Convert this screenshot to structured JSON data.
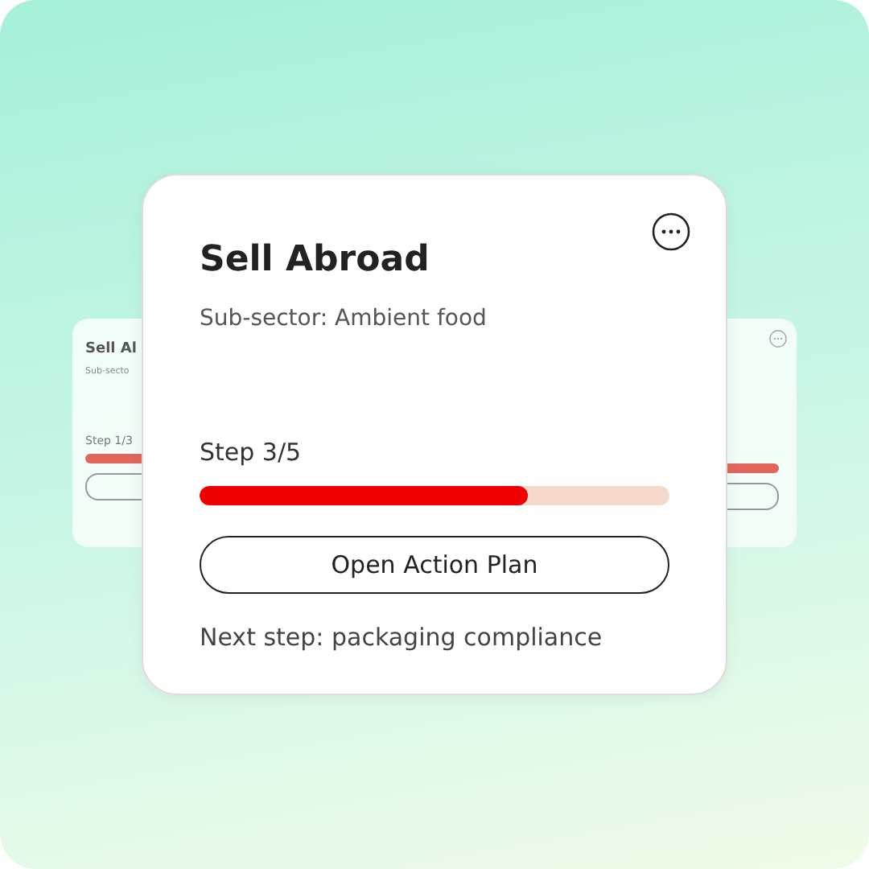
{
  "back_cards": [
    {
      "kind": "left",
      "title": "Sell Al",
      "subtitle": "Sub-secto",
      "step": "Step 1/3"
    },
    {
      "kind": "right"
    }
  ],
  "card": {
    "title": "Sell Abroad",
    "subtitle": "Sub-sector: Ambient food",
    "step": "Step 3/5",
    "level": 0.7,
    "button": "Open Action Plan",
    "next": "Next step: packaging compliance"
  }
}
